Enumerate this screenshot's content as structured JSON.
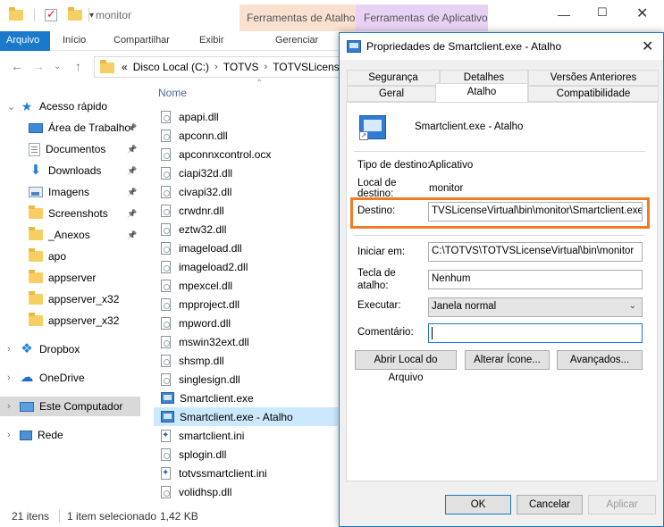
{
  "explorer": {
    "title": "monitor",
    "contextual_tabs": [
      "Ferramentas de Atalho",
      "Ferramentas de Aplicativo"
    ],
    "ribbon_tabs": [
      "Arquivo",
      "Início",
      "Compartilhar",
      "Exibir",
      "Gerenciar"
    ],
    "address": {
      "prefix": "«",
      "segments": [
        "Disco Local (C:)",
        "TOTVS",
        "TOTVSLicense"
      ]
    },
    "column_header": "Nome",
    "nav": [
      {
        "label": "Acesso rápido",
        "icon": "star-icon"
      },
      {
        "label": "Área de Trabalho",
        "icon": "desktop-icon",
        "pinned": true
      },
      {
        "label": "Documentos",
        "icon": "documents-icon",
        "pinned": true
      },
      {
        "label": "Downloads",
        "icon": "download-icon",
        "pinned": true
      },
      {
        "label": "Imagens",
        "icon": "pictures-icon",
        "pinned": true
      },
      {
        "label": "Screenshots",
        "icon": "folder-icon",
        "pinned": true
      },
      {
        "label": "_Anexos",
        "icon": "folder-icon",
        "pinned": true
      },
      {
        "label": "apo",
        "icon": "folder-icon"
      },
      {
        "label": "appserver",
        "icon": "folder-icon"
      },
      {
        "label": "appserver_x32",
        "icon": "folder-icon"
      },
      {
        "label": "appserver_x32",
        "icon": "folder-icon"
      },
      {
        "label": "Dropbox",
        "icon": "dropbox-icon"
      },
      {
        "label": "OneDrive",
        "icon": "onedrive-icon"
      },
      {
        "label": "Este Computador",
        "icon": "computer-icon",
        "selected": true
      },
      {
        "label": "Rede",
        "icon": "network-icon"
      }
    ],
    "files": [
      {
        "name": "apapi.dll",
        "type": "dll"
      },
      {
        "name": "apconn.dll",
        "type": "dll"
      },
      {
        "name": "apconnxcontrol.ocx",
        "type": "dll"
      },
      {
        "name": "ciapi32d.dll",
        "type": "dll"
      },
      {
        "name": "civapi32.dll",
        "type": "dll"
      },
      {
        "name": "crwdnr.dll",
        "type": "dll"
      },
      {
        "name": "eztw32.dll",
        "type": "dll"
      },
      {
        "name": "imageload.dll",
        "type": "dll"
      },
      {
        "name": "imageload2.dll",
        "type": "dll"
      },
      {
        "name": "mpexcel.dll",
        "type": "dll"
      },
      {
        "name": "mpproject.dll",
        "type": "dll"
      },
      {
        "name": "mpword.dll",
        "type": "dll"
      },
      {
        "name": "mswin32ext.dll",
        "type": "dll"
      },
      {
        "name": "shsmp.dll",
        "type": "dll"
      },
      {
        "name": "singlesign.dll",
        "type": "dll"
      },
      {
        "name": "Smartclient.exe",
        "type": "exe"
      },
      {
        "name": "Smartclient.exe - Atalho",
        "type": "exe",
        "selected": true
      },
      {
        "name": "smartclient.ini",
        "type": "ini"
      },
      {
        "name": "splogin.dll",
        "type": "dll"
      },
      {
        "name": "totvssmartclient.ini",
        "type": "ini"
      },
      {
        "name": "volidhsp.dll",
        "type": "dll"
      }
    ],
    "status": {
      "count": "21 itens",
      "selected": "1 item selecionado",
      "size": "1,42 KB"
    }
  },
  "dialog": {
    "title": "Propriedades de Smartclient.exe - Atalho",
    "tabs_row1": [
      "Segurança",
      "Detalhes",
      "Versões Anteriores"
    ],
    "tabs_row2": [
      "Geral",
      "Atalho",
      "Compatibilidade"
    ],
    "active_tab": "Atalho",
    "shortcut_name": "Smartclient.exe - Atalho",
    "target_type_label": "Tipo de destino:",
    "target_type_value": "Aplicativo",
    "target_location_label": "Local de destino:",
    "target_location_label_line1": "Local de",
    "target_location_label_line2": "destino:",
    "target_location_value": "monitor",
    "target_label": "Destino:",
    "target_value": "TVSLicenseVirtual\\bin\\monitor\\Smartclient.exe -m",
    "start_in_label": "Iniciar em:",
    "start_in_value": "C:\\TOTVS\\TOTVSLicenseVirtual\\bin\\monitor",
    "hotkey_label_line1": "Tecla de",
    "hotkey_label_line2": "atalho:",
    "hotkey_value": "Nenhum",
    "run_label": "Executar:",
    "run_value": "Janela normal",
    "comment_label": "Comentário:",
    "comment_value": "",
    "buttons": {
      "open_location": "Abrir Local do Arquivo",
      "change_icon": "Alterar Ícone...",
      "advanced": "Avançados...",
      "ok": "OK",
      "cancel": "Cancelar",
      "apply": "Aplicar"
    },
    "accent_color": "#ef7c24"
  }
}
